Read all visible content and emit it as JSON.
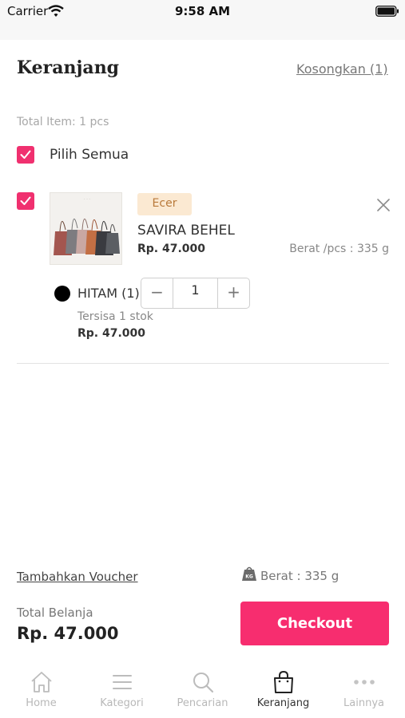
{
  "status_bar": {
    "carrier": "Carrier",
    "time": "9:58 AM"
  },
  "header": {
    "title": "Keranjang",
    "clear_label": "Kosongkan (1)"
  },
  "summary": {
    "total_item": "Total Item: 1 pcs",
    "select_all_label": "Pilih Semua",
    "select_all_checked": true
  },
  "cart_item": {
    "checked": true,
    "badge": "Ecer",
    "name": "SAVIRA BEHEL",
    "price": "Rp. 47.000",
    "weight": "Berat /pcs : 335 g",
    "variant": {
      "name": "HITAM (1)",
      "color": "#000000",
      "quantity": "1",
      "minus": "−",
      "plus": "+",
      "stock": "Tersisa 1 stok",
      "price": "Rp. 47.000"
    }
  },
  "footer": {
    "voucher_label": "Tambahkan Voucher",
    "weight_summary": "Berat : 335 g",
    "total_label": "Total Belanja",
    "total_value": "Rp. 47.000",
    "checkout_label": "Checkout"
  },
  "tabs": [
    {
      "label": "Home",
      "icon": "home-icon",
      "active": false
    },
    {
      "label": "Kategori",
      "icon": "menu-icon",
      "active": false
    },
    {
      "label": "Pencarian",
      "icon": "search-icon",
      "active": false
    },
    {
      "label": "Keranjang",
      "icon": "bag-icon",
      "active": true
    },
    {
      "label": "Lainnya",
      "icon": "more-icon",
      "active": false
    }
  ],
  "colors": {
    "accent": "#f72d6f",
    "checkbox": "#f0306f",
    "badge_bg": "#fbe9d2",
    "badge_text": "#b9793a"
  }
}
